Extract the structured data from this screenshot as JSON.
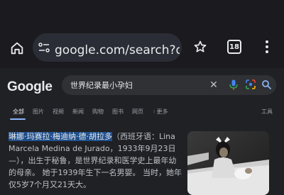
{
  "browser": {
    "url": "google.com/search?q=世",
    "tab_count": "18"
  },
  "google": {
    "logo": "Google",
    "query": "世界纪录最小孕妇"
  },
  "tabs": {
    "items": [
      "全部",
      "图片",
      "视频",
      "新闻",
      "购物",
      "图书",
      "网页"
    ],
    "more": "更多",
    "tools": "工具"
  },
  "result": {
    "name_highlight": "琳娜·玛赛拉·梅迪纳·德·胡拉多",
    "text": "（西班牙语：Lina Marcela Medina de Jurado，1933年9月23日—），出生于秘鲁，是世界纪录和医学史上最年幼的母亲。 她于1939年生下一名男婴。 当时，她年仅5岁7个月又21天大。"
  },
  "icons": {
    "home": "home-icon",
    "site_settings": "tune-icon",
    "bookmark": "star-icon",
    "menu": "more-vert-icon",
    "clear": "close-icon",
    "voice": "mic-icon",
    "lens": "camera-lens-icon",
    "search": "search-icon",
    "more_tabs": "grid-dots-icon"
  },
  "colors": {
    "background": "#202124",
    "toolbar": "#1b1b1f",
    "url_pill": "#2b2d36",
    "search_box": "#303134",
    "accent": "#8ab4f8",
    "highlight": "#1f4f8c"
  }
}
